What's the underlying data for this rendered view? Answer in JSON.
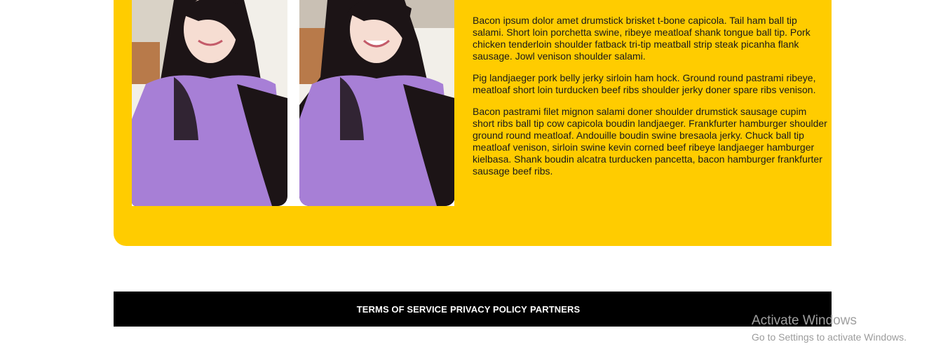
{
  "content": {
    "paragraphs": [
      "Bacon ipsum dolor amet drumstick brisket t-bone capicola. Tail ham ball tip salami. Short loin porchetta swine, ribeye meatloaf shank tongue ball tip. Pork chicken tenderloin shoulder fatback tri-tip meatball strip steak picanha flank sausage. Jowl venison shoulder salami.",
      "Pig landjaeger pork belly jerky sirloin ham hock. Ground round pastrami ribeye, meatloaf short loin turducken beef ribs shoulder jerky doner spare ribs venison.",
      "Bacon pastrami filet mignon salami doner shoulder drumstick sausage cupim short ribs ball tip cow capicola boudin landjaeger. Frankfurter hamburger shoulder ground round meatloaf. Andouille boudin swine bresaola jerky. Chuck ball tip meatloaf venison, sirloin swine kevin corned beef ribeye landjaeger hamburger kielbasa. Shank boudin alcatra turducken pancetta, bacon hamburger frankfurter sausage beef ribs."
    ]
  },
  "footer": {
    "links": [
      "TERMS OF SERVICE",
      "PRIVACY POLICY",
      "PARTNERS"
    ]
  },
  "watermark": {
    "title": "Activate Windows",
    "subtitle": "Go to Settings to activate Windows."
  },
  "colors": {
    "panel": "#ffcc00",
    "footer_bg": "#000000",
    "shirt": "#a77fd6",
    "hair": "#1c1416"
  }
}
